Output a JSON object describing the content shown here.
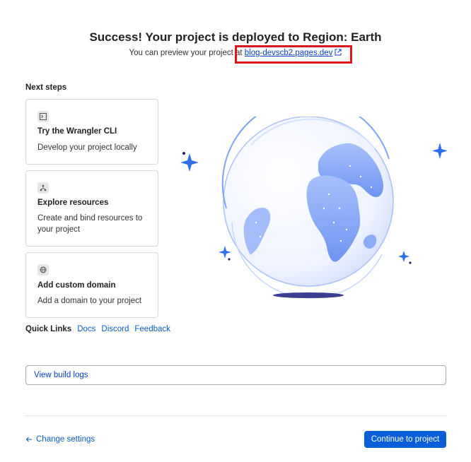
{
  "header": {
    "title": "Success! Your project is deployed to Region: Earth",
    "preview_prefix": "You can preview your project at",
    "preview_link": "blog-devscb2.pages.dev"
  },
  "next_steps": {
    "heading": "Next steps",
    "cards": [
      {
        "icon": "terminal-icon",
        "title": "Try the Wrangler CLI",
        "desc": "Develop your project locally"
      },
      {
        "icon": "resources-icon",
        "title": "Explore resources",
        "desc": "Create and bind resources to your project"
      },
      {
        "icon": "globe-icon",
        "title": "Add custom domain",
        "desc": "Add a domain to your project"
      }
    ]
  },
  "quick_links": {
    "label": "Quick Links",
    "links": [
      "Docs",
      "Discord",
      "Feedback"
    ]
  },
  "build_logs": {
    "label": "View build logs"
  },
  "footer": {
    "change_settings": "Change settings",
    "continue": "Continue to project"
  },
  "colors": {
    "accent": "#0a5fd9",
    "link": "#0a5dc2",
    "highlight": "#d9181e",
    "globe": "#7fa3f5"
  }
}
